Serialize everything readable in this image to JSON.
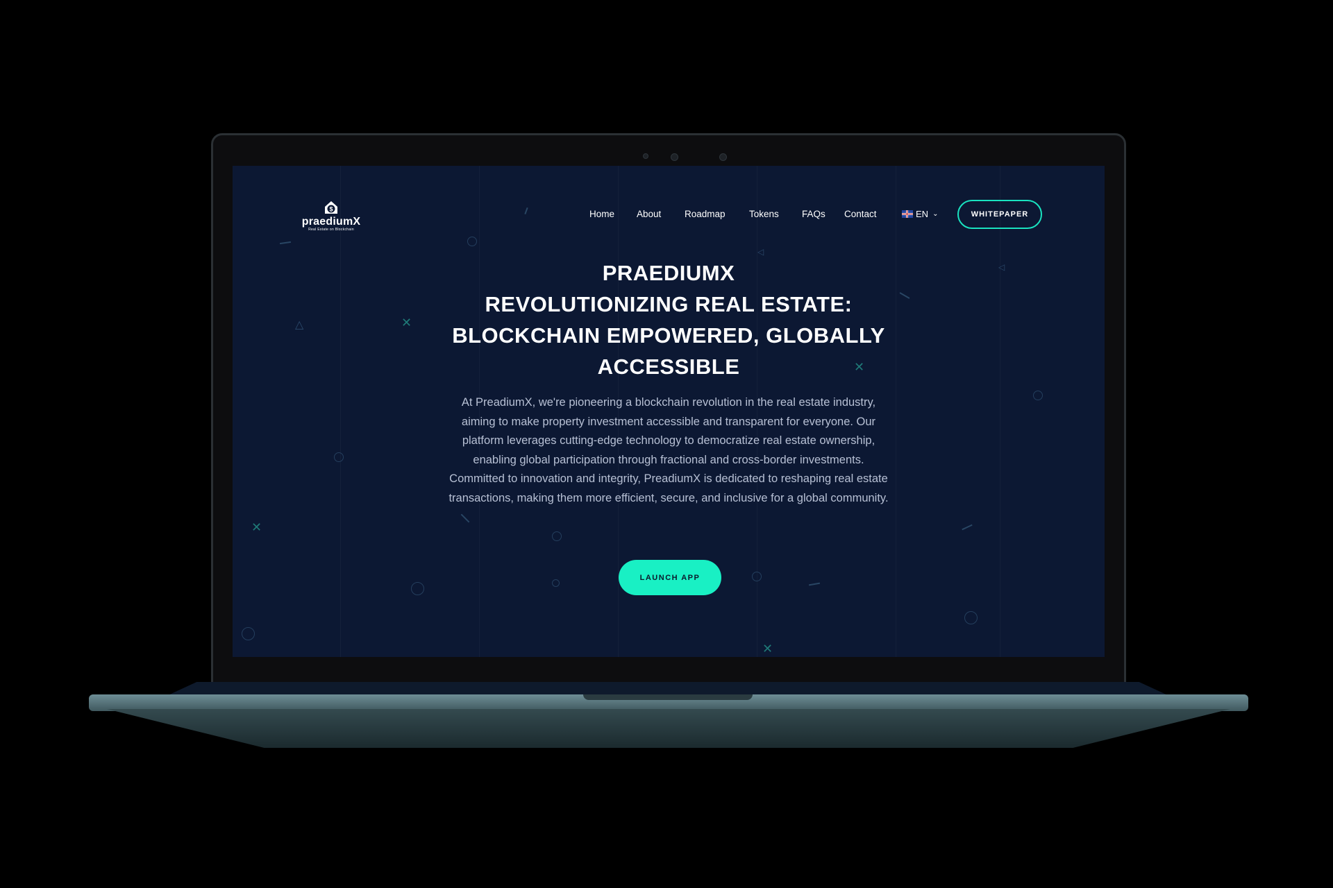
{
  "logo": {
    "name": "praediumX",
    "tagline": "Real Estate on Blockchain"
  },
  "nav": {
    "items": [
      "Home",
      "About",
      "Roadmap",
      "Tokens",
      "FAQs",
      "Contact"
    ],
    "language": "EN",
    "whitepaper_label": "WHITEPAPER"
  },
  "hero": {
    "title_lines": [
      "PRAEDIUMX",
      "REVOLUTIONIZING REAL ESTATE:",
      "BLOCKCHAIN EMPOWERED, GLOBALLY",
      "ACCESSIBLE"
    ],
    "description": "At PreadiumX, we're pioneering a blockchain revolution in the real estate industry, aiming to make property investment accessible and transparent for everyone. Our platform leverages cutting-edge technology to democratize real estate ownership, enabling global participation through fractional and cross-border investments. Committed to innovation and integrity, PreadiumX is dedicated to reshaping real estate transactions, making them more efficient, secure, and inclusive for a global community.",
    "cta_label": "LAUNCH APP"
  },
  "colors": {
    "background": "#0c1833",
    "accent": "#19f0c4",
    "text": "#ffffff",
    "muted_text": "#b7c0d4"
  }
}
